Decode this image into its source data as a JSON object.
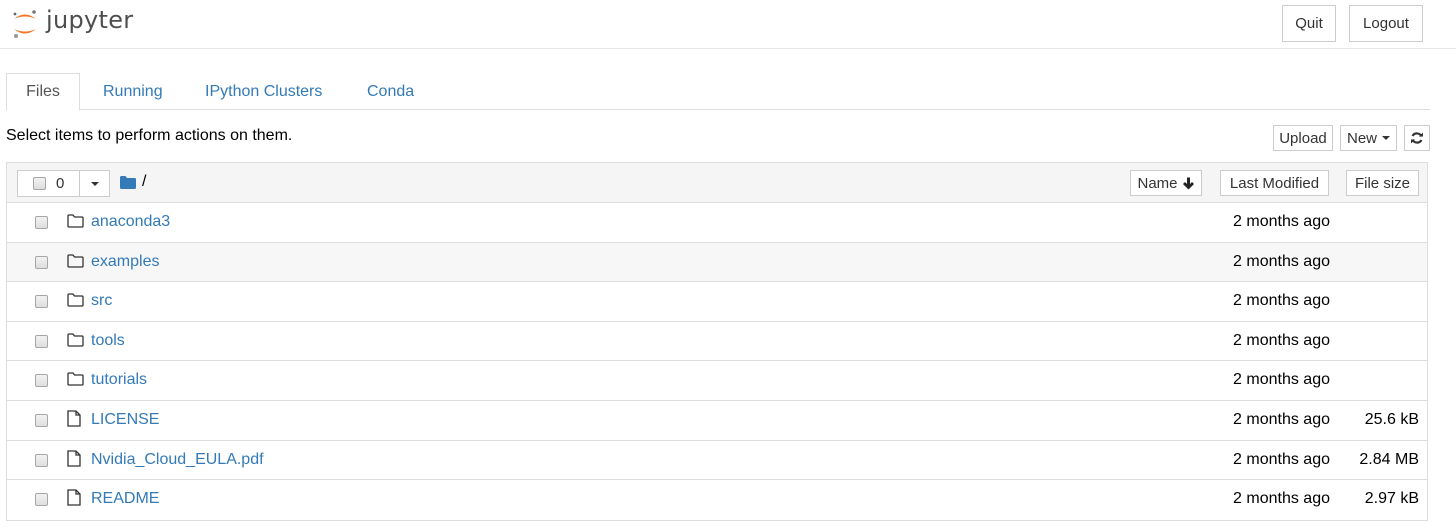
{
  "header": {
    "logo_text": "jupyter",
    "quit_label": "Quit",
    "logout_label": "Logout",
    "brand_color": "#f37726"
  },
  "tabs": [
    {
      "label": "Files",
      "active": true
    },
    {
      "label": "Running",
      "active": false
    },
    {
      "label": "IPython Clusters",
      "active": false
    },
    {
      "label": "Conda",
      "active": false
    }
  ],
  "toolbar": {
    "hint": "Select items to perform actions on them.",
    "upload_label": "Upload",
    "new_label": "New",
    "refresh_icon": "refresh-icon"
  },
  "list_header": {
    "selected_count": "0",
    "breadcrumb_path": "/",
    "sort_name_label": "Name",
    "sort_modified_label": "Last Modified",
    "sort_size_label": "File size"
  },
  "items": [
    {
      "name": "anaconda3",
      "type": "folder",
      "modified": "2 months ago",
      "size": ""
    },
    {
      "name": "examples",
      "type": "folder",
      "modified": "2 months ago",
      "size": ""
    },
    {
      "name": "src",
      "type": "folder",
      "modified": "2 months ago",
      "size": ""
    },
    {
      "name": "tools",
      "type": "folder",
      "modified": "2 months ago",
      "size": ""
    },
    {
      "name": "tutorials",
      "type": "folder",
      "modified": "2 months ago",
      "size": ""
    },
    {
      "name": "LICENSE",
      "type": "file",
      "modified": "2 months ago",
      "size": "25.6 kB"
    },
    {
      "name": "Nvidia_Cloud_EULA.pdf",
      "type": "file",
      "modified": "2 months ago",
      "size": "2.84 MB"
    },
    {
      "name": "README",
      "type": "file",
      "modified": "2 months ago",
      "size": "2.97 kB"
    }
  ]
}
